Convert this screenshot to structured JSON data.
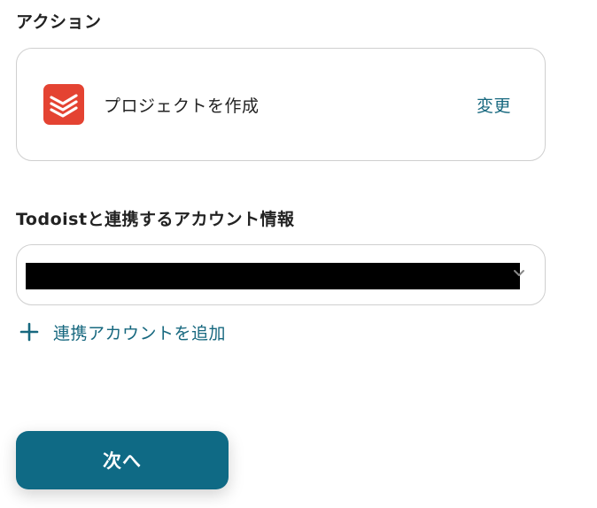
{
  "action_section": {
    "label": "アクション",
    "app": {
      "icon": "todoist-icon",
      "brand_color": "#e44332"
    },
    "action_title": "プロジェクトを作成",
    "change_label": "変更"
  },
  "account_section": {
    "label": "Todoistと連携するアカウント情報",
    "selected_value_redacted": true,
    "add_account_label": "連携アカウントを追加"
  },
  "footer": {
    "next_label": "次へ"
  },
  "colors": {
    "accent": "#17687f",
    "button": "#0f6a85",
    "border": "#cfcfcf"
  }
}
